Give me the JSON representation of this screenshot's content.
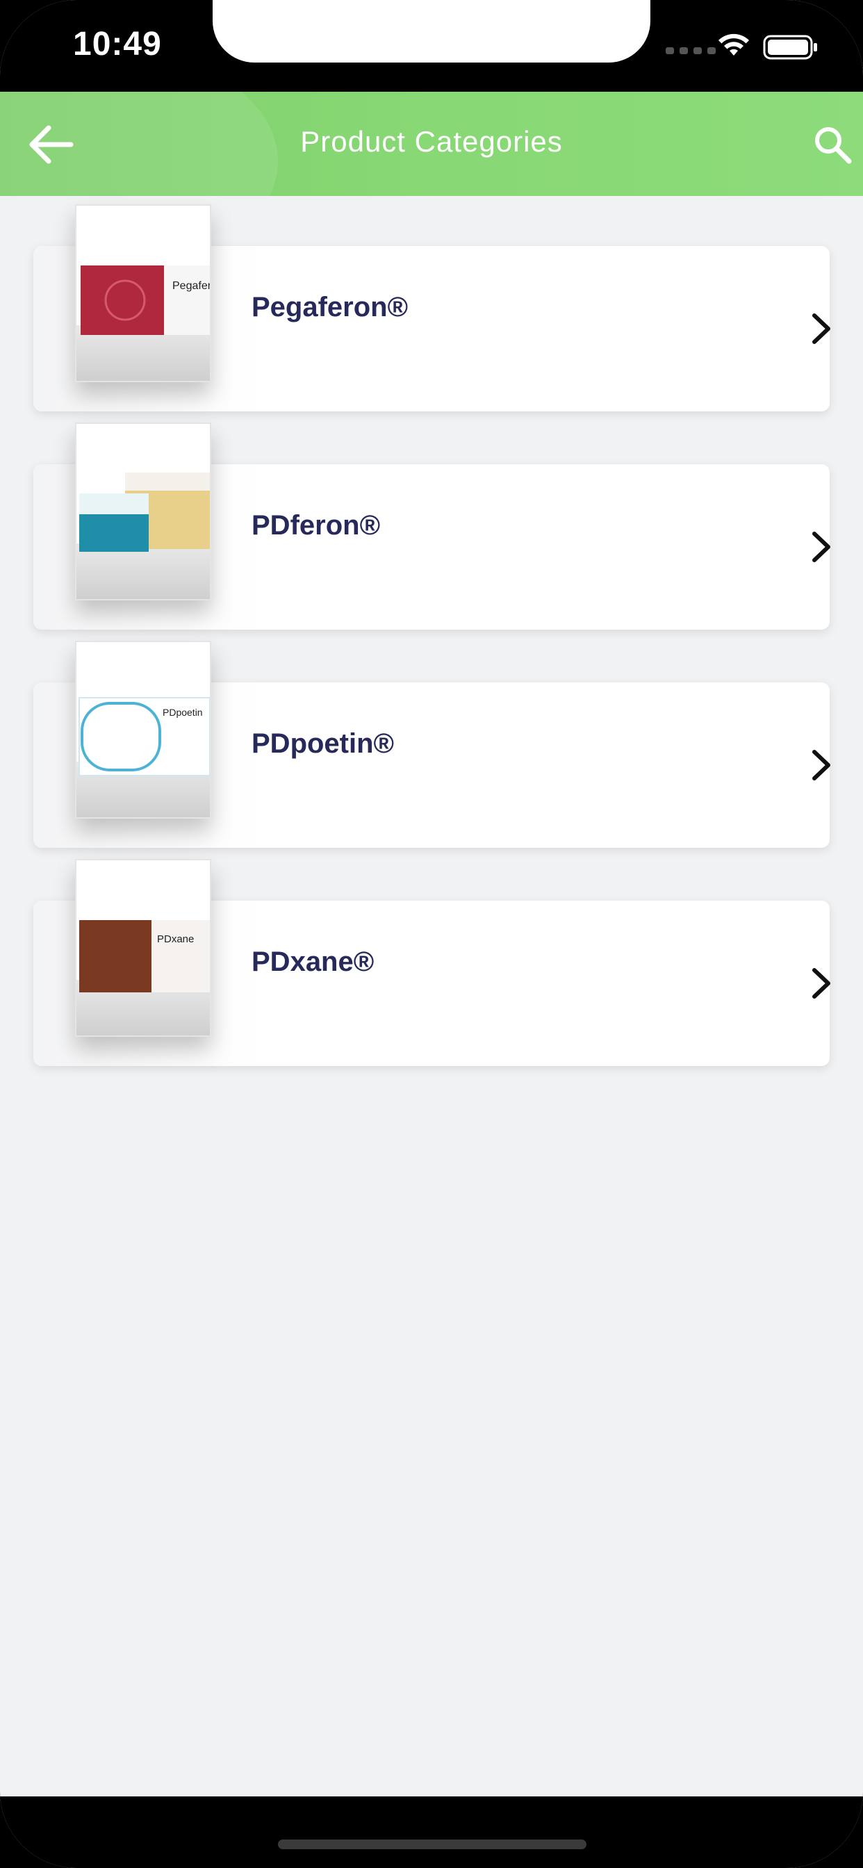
{
  "status_bar": {
    "time": "10:49"
  },
  "header": {
    "title": "Product Categories"
  },
  "products": [
    {
      "name": "Pegaferon®",
      "box_color": "#b0283c",
      "accent": "#c0304a"
    },
    {
      "name": "PDferon®",
      "box_color": "#1f8ea8",
      "accent": "#d9b24a"
    },
    {
      "name": "PDpoetin®",
      "box_color": "#ffffff",
      "accent": "#4db3d6"
    },
    {
      "name": "PDxane®",
      "box_color": "#7a3a22",
      "accent": "#8f4a2c"
    }
  ],
  "colors": {
    "header_green": "#88d875",
    "title_text": "#27295a",
    "background": "#f1f2f4"
  },
  "icons": [
    "back-arrow-icon",
    "search-icon",
    "chevron-right-icon",
    "wifi-icon",
    "battery-icon"
  ]
}
